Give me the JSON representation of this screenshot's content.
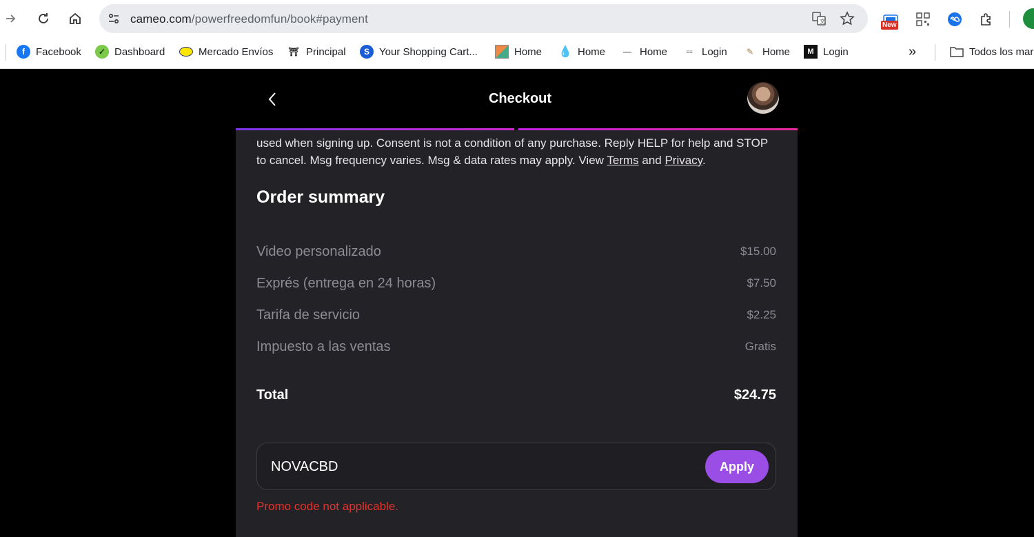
{
  "browser": {
    "url_domain": "cameo.com",
    "url_path": "/powerfreedomfun/book#payment",
    "new_badge": "New"
  },
  "bookmarks": {
    "items": [
      {
        "label": "Facebook",
        "icon": "facebook-icon"
      },
      {
        "label": "Dashboard",
        "icon": "dashboard-icon"
      },
      {
        "label": "Mercado Envíos",
        "icon": "mercado-envios-icon"
      },
      {
        "label": "Principal",
        "icon": "principal-icon"
      },
      {
        "label": "Your Shopping Cart...",
        "icon": "shopping-cart-icon"
      },
      {
        "label": "Home",
        "icon": "home-image-icon"
      },
      {
        "label": "Home",
        "icon": "drop-icon"
      },
      {
        "label": "Home",
        "icon": "line-icon"
      },
      {
        "label": "Login",
        "icon": "login-icon"
      },
      {
        "label": "Home",
        "icon": "feather-icon"
      },
      {
        "label": "Login",
        "icon": "m-icon"
      }
    ],
    "more": "»",
    "folder_label": "Todos los mar"
  },
  "checkout": {
    "title": "Checkout",
    "consent_text": "used when signing up. Consent is not a condition of any purchase. Reply HELP for help and STOP to cancel. Msg frequency varies. Msg & data rates may apply. View ",
    "terms_label": "Terms",
    "and_label": " and ",
    "privacy_label": "Privacy",
    "period": "."
  },
  "order_summary": {
    "title": "Order summary",
    "items": [
      {
        "label": "Video personalizado",
        "value": "$15.00"
      },
      {
        "label": "Exprés (entrega en 24 horas)",
        "value": "$7.50"
      },
      {
        "label": "Tarifa de servicio",
        "value": "$2.25"
      },
      {
        "label": "Impuesto a las ventas",
        "value": "Gratis"
      }
    ],
    "total_label": "Total",
    "total_value": "$24.75"
  },
  "promo": {
    "value": "NOVACBD",
    "apply_label": "Apply",
    "error": "Promo code not applicable."
  },
  "colors": {
    "accent": "#9a4ee6",
    "error": "#e0342e",
    "panel": "#232226"
  }
}
